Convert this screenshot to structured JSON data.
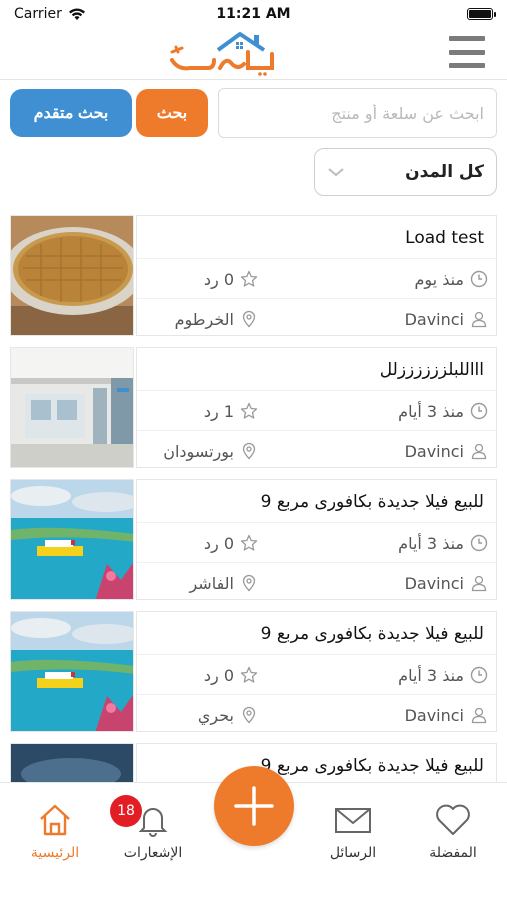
{
  "status_bar": {
    "carrier": "Carrier",
    "time": "11:21 AM"
  },
  "header": {
    "logo_text": "ترويج",
    "menu_icon": "hamburger-icon"
  },
  "search": {
    "placeholder": "ابحث عن سلعة أو منتج",
    "search_label": "بحث",
    "advanced_label": "بحث متقدم",
    "city_selected": "كل المدن"
  },
  "listings": [
    {
      "title": "Load test",
      "time": "منذ يوم",
      "replies": "0 رد",
      "user": "Davinci",
      "city": "الخرطوم",
      "thumb": "food-tray"
    },
    {
      "title": "اااللبلززززززلل",
      "time": "منذ 3 أيام",
      "replies": "1 رد",
      "user": "Davinci",
      "city": "بورتسودان",
      "thumb": "store-interior"
    },
    {
      "title": "للبيع فيلا جديدة بكافورى مربع 9",
      "time": "منذ 3 أيام",
      "replies": "0 رد",
      "user": "Davinci",
      "city": "الفاشر",
      "thumb": "sea-ship"
    },
    {
      "title": "للبيع فيلا جديدة بكافورى مربع 9",
      "time": "منذ 3 أيام",
      "replies": "0 رد",
      "user": "Davinci",
      "city": "بحري",
      "thumb": "sea-ship"
    },
    {
      "title": "للبيع فيلا جديدة بكافورى مربع 9",
      "time": "",
      "replies": "",
      "user": "",
      "city": "",
      "thumb": "sky"
    }
  ],
  "bottom_nav": {
    "home": "الرئيسية",
    "notifications": "الإشعارات",
    "notifications_count": "18",
    "messages": "الرسائل",
    "favorites": "المفضلة"
  },
  "colors": {
    "accent": "#ee7a2b",
    "primary_blue": "#3f8fd2",
    "badge": "#e31d24"
  }
}
